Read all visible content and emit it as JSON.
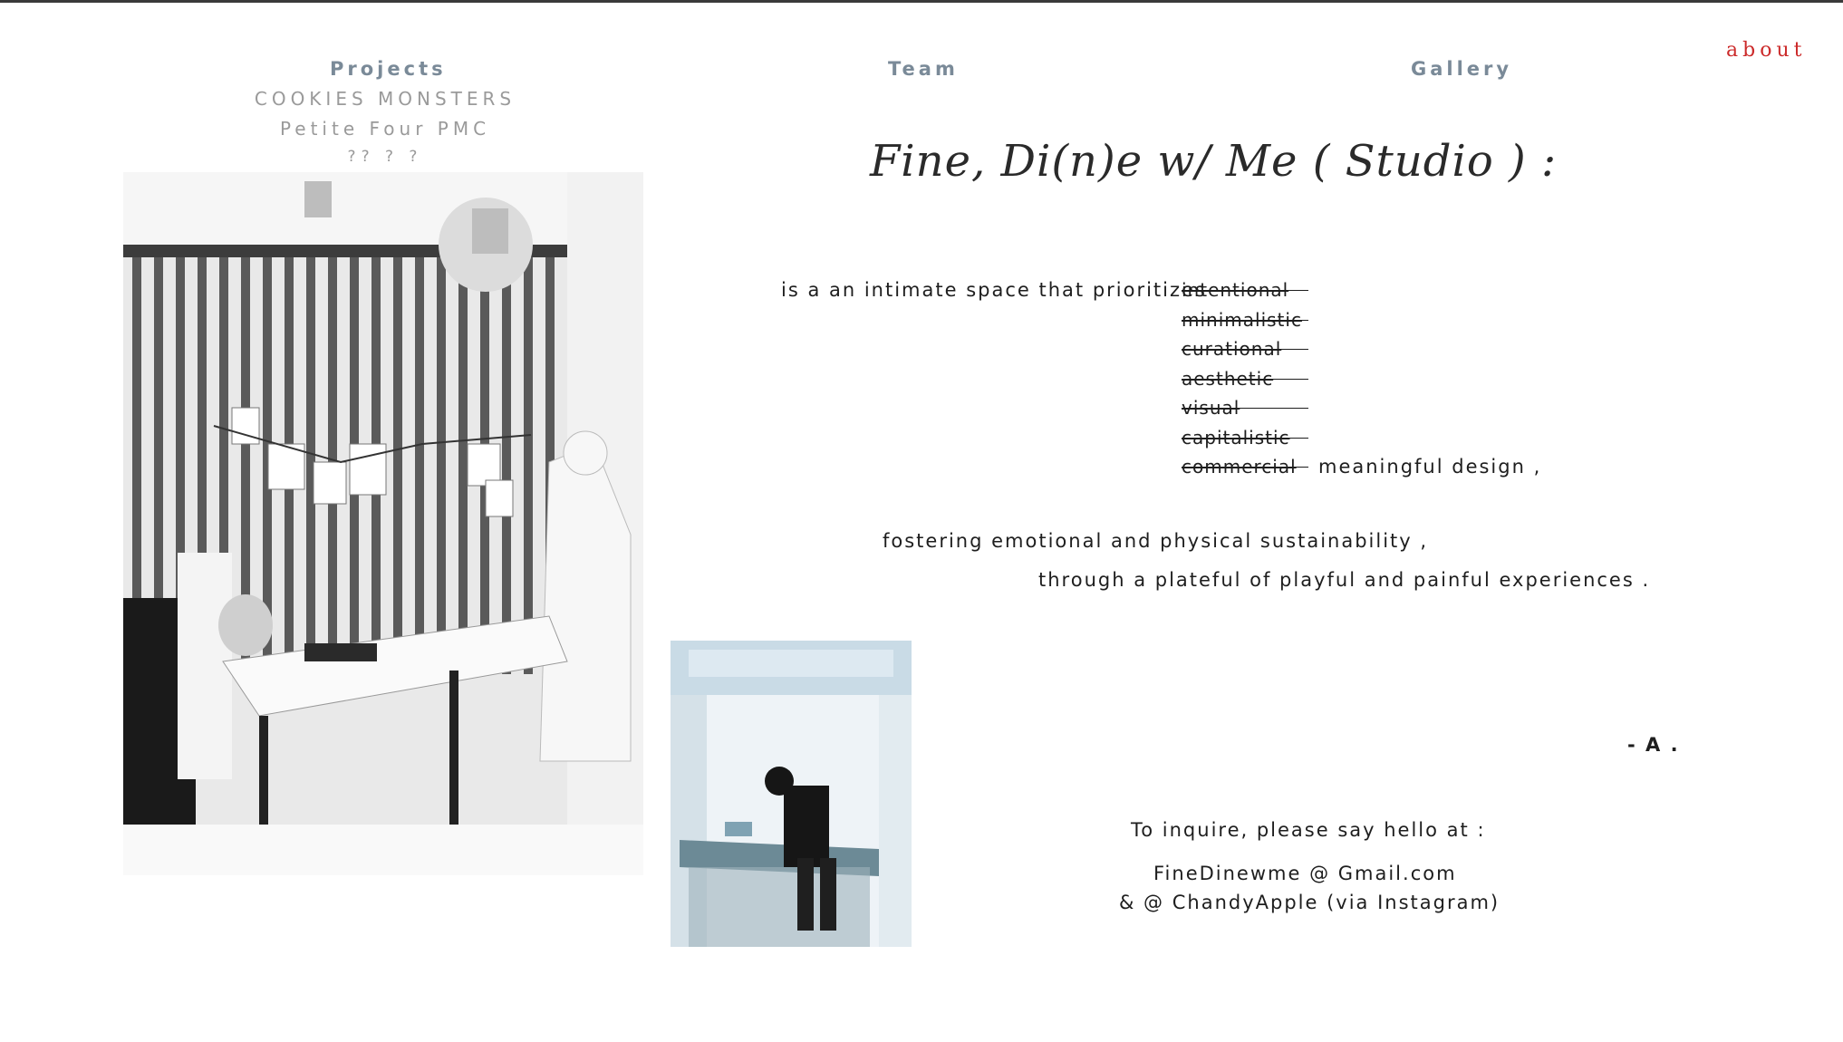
{
  "nav": {
    "projects": "Projects",
    "team": "Team",
    "gallery": "Gallery",
    "about": "about"
  },
  "projects_menu": {
    "items": [
      "COOKIES MONSTERS",
      "Petite Four PMC",
      "?? ? ?"
    ]
  },
  "main": {
    "title": "Fine, Di(n)e w/ Me ( Studio ) :",
    "intro": "is a an intimate space that prioritizes",
    "struck_words": [
      "intentional",
      "minimalistic",
      "curational",
      "aesthetic",
      "visual",
      "capitalistic",
      "commercial"
    ],
    "meaningful": "meaningful design ,",
    "fostering": "fostering emotional and physical sustainability ,",
    "through": "through a plateful of playful and painful experiences .",
    "signoff": "- A ."
  },
  "contact": {
    "inquire": "To inquire, please say hello at :",
    "email": "FineDinewme @ Gmail.com",
    "instagram": "& @ ChandyApple (via Instagram)"
  },
  "colors": {
    "nav": "#7a8a98",
    "about": "#cc2b2b",
    "submenu": "#9a9a9a",
    "text": "#1e1e1e"
  }
}
